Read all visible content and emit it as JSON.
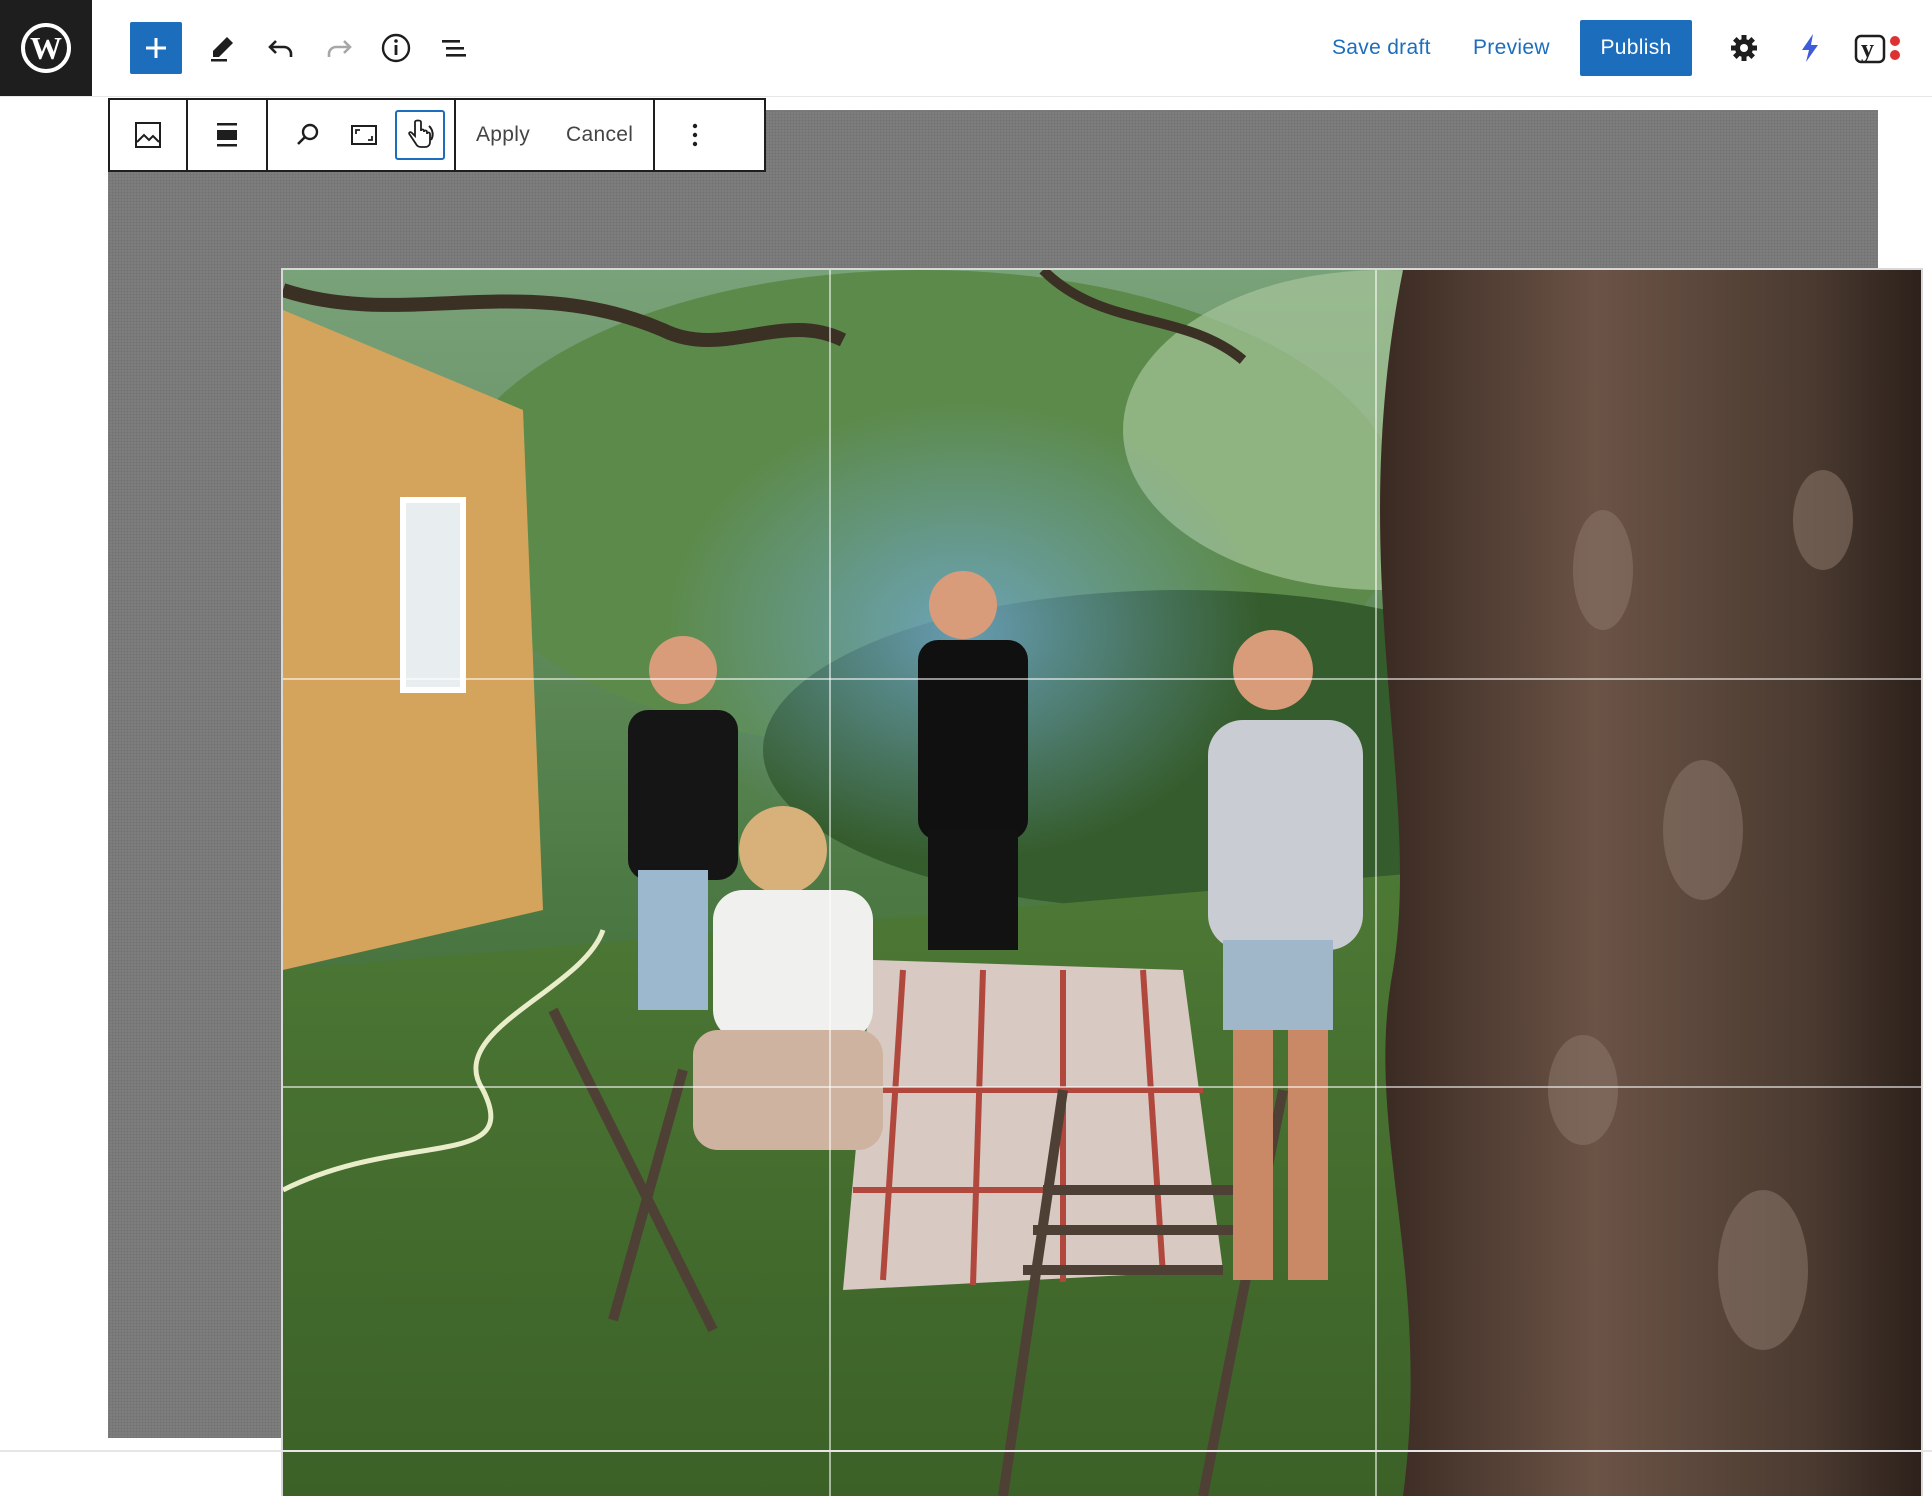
{
  "header": {
    "logo_icon": "wordpress-logo",
    "logo_letter": "W",
    "toolbar_icons": [
      "add-block-icon",
      "pencil-tools-icon",
      "undo-icon",
      "redo-icon",
      "info-icon",
      "list-view-icon"
    ],
    "save_draft_label": "Save draft",
    "preview_label": "Preview",
    "publish_label": "Publish",
    "right_icons": [
      "settings-gear-icon",
      "jetpack-bolt-icon",
      "yoast-icon"
    ],
    "yoast_glyph": "y"
  },
  "block_toolbar": {
    "icons": [
      "image-block-icon",
      "align-icon",
      "zoom-icon",
      "aspect-ratio-icon",
      "rotate-hand-icon",
      "more-options-icon"
    ],
    "apply_label": "Apply",
    "cancel_label": "Cancel"
  },
  "image": {
    "description_icon": "photo-garden-dinner",
    "crop_grid": "rule-of-thirds"
  },
  "colors": {
    "accent": "#1c6ebd",
    "topbar_logo_bg": "#1e1e1e",
    "canvas_bg": "#7d7d7d"
  }
}
